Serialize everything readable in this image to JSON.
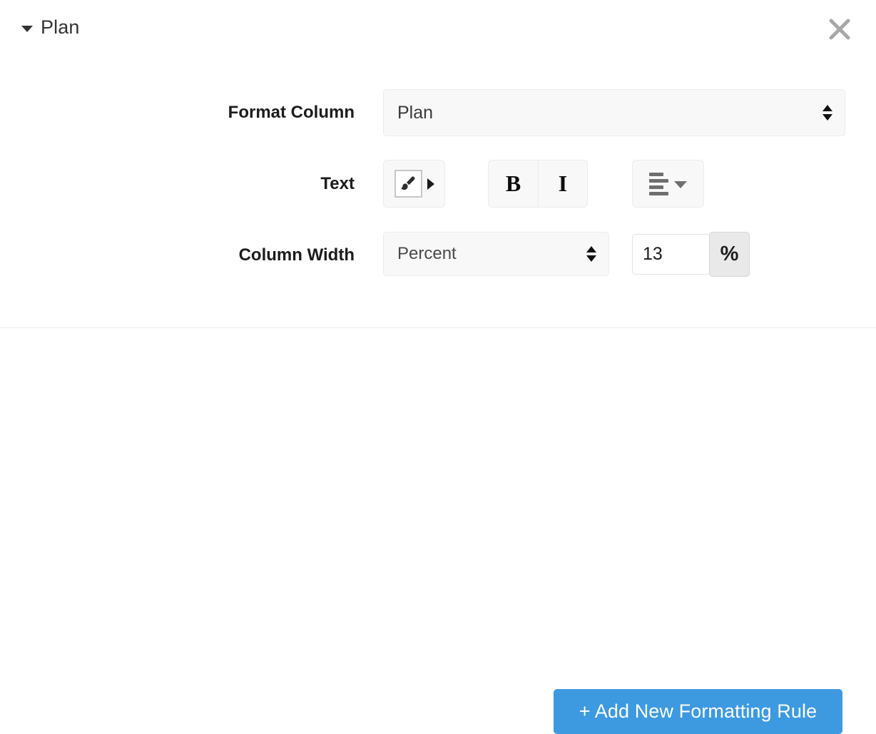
{
  "panel": {
    "title": "Plan",
    "collapse_icon": "triangle-down-icon",
    "close_icon": "close-icon",
    "accent_color": "#3d9ae1"
  },
  "rows": {
    "format_column": {
      "label": "Format Column",
      "select_value": "Plan",
      "stepper_icon": "up-down-arrows-icon"
    },
    "text": {
      "label": "Text",
      "brush_icon": "paintbrush-icon",
      "brush_caret_icon": "caret-right-icon",
      "bold_label": "B",
      "italic_label": "I",
      "align_icon": "align-left-icon",
      "align_caret_icon": "caret-down-icon"
    },
    "column_width": {
      "label": "Column Width",
      "unit_value": "Percent",
      "stepper_icon": "up-down-arrows-icon",
      "amount_value": "13",
      "unit_suffix": "%"
    }
  },
  "footer": {
    "add_rule_label": "+ Add New Formatting Rule"
  }
}
